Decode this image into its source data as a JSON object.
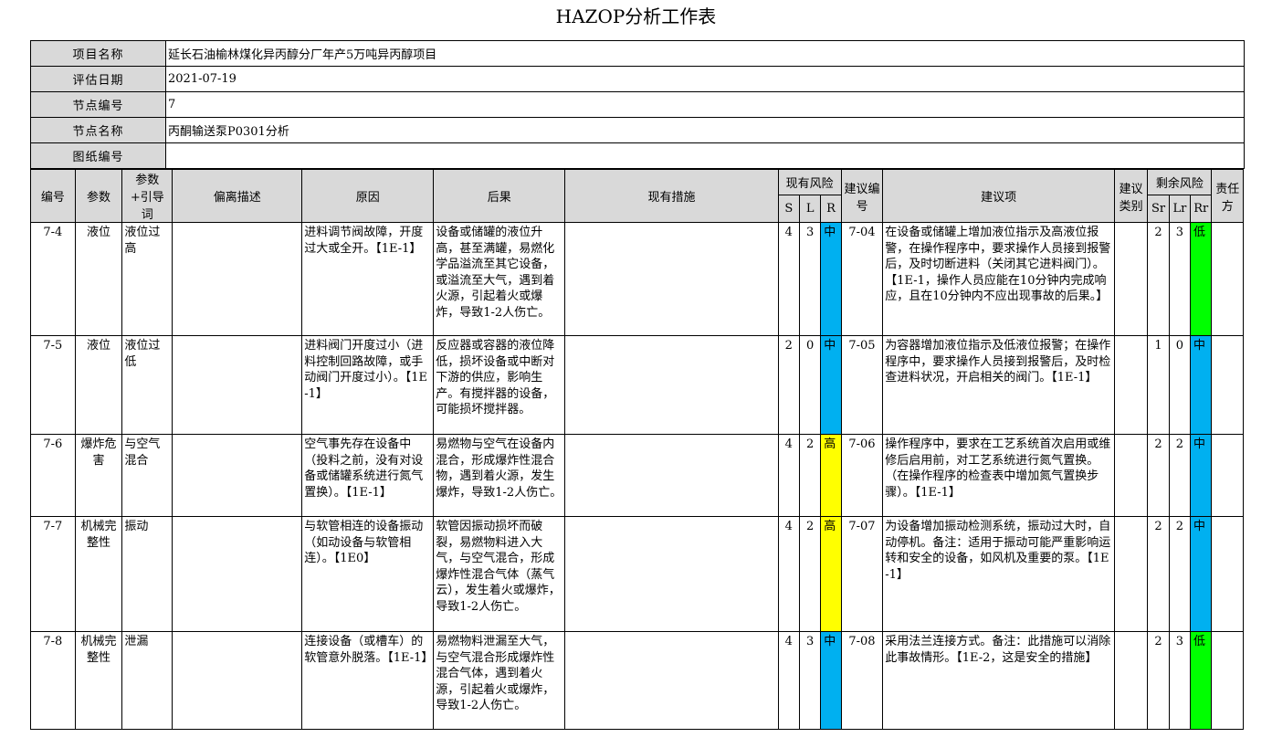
{
  "title": "HAZOP分析工作表",
  "info": {
    "project_name_label": "项目名称",
    "project_name": "延长石油榆林煤化异丙醇分厂年产5万吨异丙醇项目",
    "eval_date_label": "评估日期",
    "eval_date": "2021-07-19",
    "node_no_label": "节点编号",
    "node_no": "7",
    "node_name_label": "节点名称",
    "node_name": "丙酮输送泵P0301分析",
    "drawing_no_label": "图纸编号",
    "drawing_no": ""
  },
  "headers": {
    "no": "编号",
    "param": "参数",
    "guide": "参数+引导词",
    "deviation": "偏离描述",
    "cause": "原因",
    "consequence": "后果",
    "measures": "现有措施",
    "current_risk": "现有风险",
    "s": "S",
    "l": "L",
    "r": "R",
    "rec_no": "建议编号",
    "rec": "建议项",
    "rec_type": "建议类别",
    "residual_risk": "剩余风险",
    "sr": "Sr",
    "lr": "Lr",
    "rr": "Rr",
    "owner": "责任方"
  },
  "rows": [
    {
      "no": "7-4",
      "param": "液位",
      "guide": "液位过高",
      "deviation": "",
      "cause": "进料调节阀故障，开度过大或全开。【1E-1】",
      "consequence": "设备或储罐的液位升高，甚至满罐，易燃化学品溢流至其它设备，或溢流至大气，遇到着火源，引起着火或爆炸，导致1-2人伤亡。",
      "measures": "",
      "s": "4",
      "l": "3",
      "r": "中",
      "rec_no": "7-04",
      "rec": "在设备或储罐上增加液位指示及高液位报警，在操作程序中，要求操作人员接到报警后，及时切断进料（关闭其它进料阀门）。【1E-1，操作人员应能在10分钟内完成响应，且在10分钟内不应出现事故的后果。】",
      "rec_type": "",
      "sr": "2",
      "lr": "3",
      "rr": "低",
      "owner": ""
    },
    {
      "no": "7-5",
      "param": "液位",
      "guide": "液位过低",
      "deviation": "",
      "cause": "进料阀门开度过小（进料控制回路故障，或手动阀门开度过小）。【1E-1】",
      "consequence": "反应器或容器的液位降低，损坏设备或中断对下游的供应，影响生产。有搅拌器的设备，可能损坏搅拌器。",
      "measures": "",
      "s": "2",
      "l": "0",
      "r": "中",
      "rec_no": "7-05",
      "rec": "为容器增加液位指示及低液位报警；在操作程序中，要求操作人员接到报警后，及时检查进料状况，开启相关的阀门。【1E-1】",
      "rec_type": "",
      "sr": "1",
      "lr": "0",
      "rr": "中",
      "owner": ""
    },
    {
      "no": "7-6",
      "param": "爆炸危害",
      "guide": "与空气混合",
      "deviation": "",
      "cause": "空气事先存在设备中（投料之前，没有对设备或储罐系统进行氮气置换）。【1E-1】",
      "consequence": "易燃物与空气在设备内混合，形成爆炸性混合物，遇到着火源，发生爆炸，导致1-2人伤亡。",
      "measures": "",
      "s": "4",
      "l": "2",
      "r": "高",
      "rec_no": "7-06",
      "rec": "操作程序中，要求在工艺系统首次启用或维修后启用前，对工艺系统进行氮气置换。（在操作程序的检查表中增加氮气置换步骤）。【1E-1】",
      "rec_type": "",
      "sr": "2",
      "lr": "2",
      "rr": "中",
      "owner": ""
    },
    {
      "no": "7-7",
      "param": "机械完整性",
      "guide": "振动",
      "deviation": "",
      "cause": "与软管相连的设备振动（如动设备与软管相连）。【1E0】",
      "consequence": "软管因振动损坏而破裂，易燃物料进入大气，与空气混合，形成爆炸性混合气体（蒸气云），发生着火或爆炸，导致1-2人伤亡。",
      "measures": "",
      "s": "4",
      "l": "2",
      "r": "高",
      "rec_no": "7-07",
      "rec": "为设备增加振动检测系统，振动过大时，自动停机。备注：适用于振动可能严重影响运转和安全的设备，如风机及重要的泵。【1E-1】",
      "rec_type": "",
      "sr": "2",
      "lr": "2",
      "rr": "中",
      "owner": ""
    },
    {
      "no": "7-8",
      "param": "机械完整性",
      "guide": "泄漏",
      "deviation": "",
      "cause": "连接设备（或槽车）的软管意外脱落。【1E-1】",
      "consequence": "易燃物料泄漏至大气，与空气混合形成爆炸性混合气体，遇到着火源，引起着火或爆炸，导致1-2人伤亡。",
      "measures": "",
      "s": "4",
      "l": "3",
      "r": "中",
      "rec_no": "7-08",
      "rec": "采用法兰连接方式。备注：此措施可以消除此事故情形。【1E-2，这是安全的措施】",
      "rec_type": "",
      "sr": "2",
      "lr": "3",
      "rr": "低",
      "owner": ""
    }
  ],
  "risk_colors": {
    "中": "#00b0f0",
    "高": "#ffff00",
    "低": "#00ff00"
  }
}
